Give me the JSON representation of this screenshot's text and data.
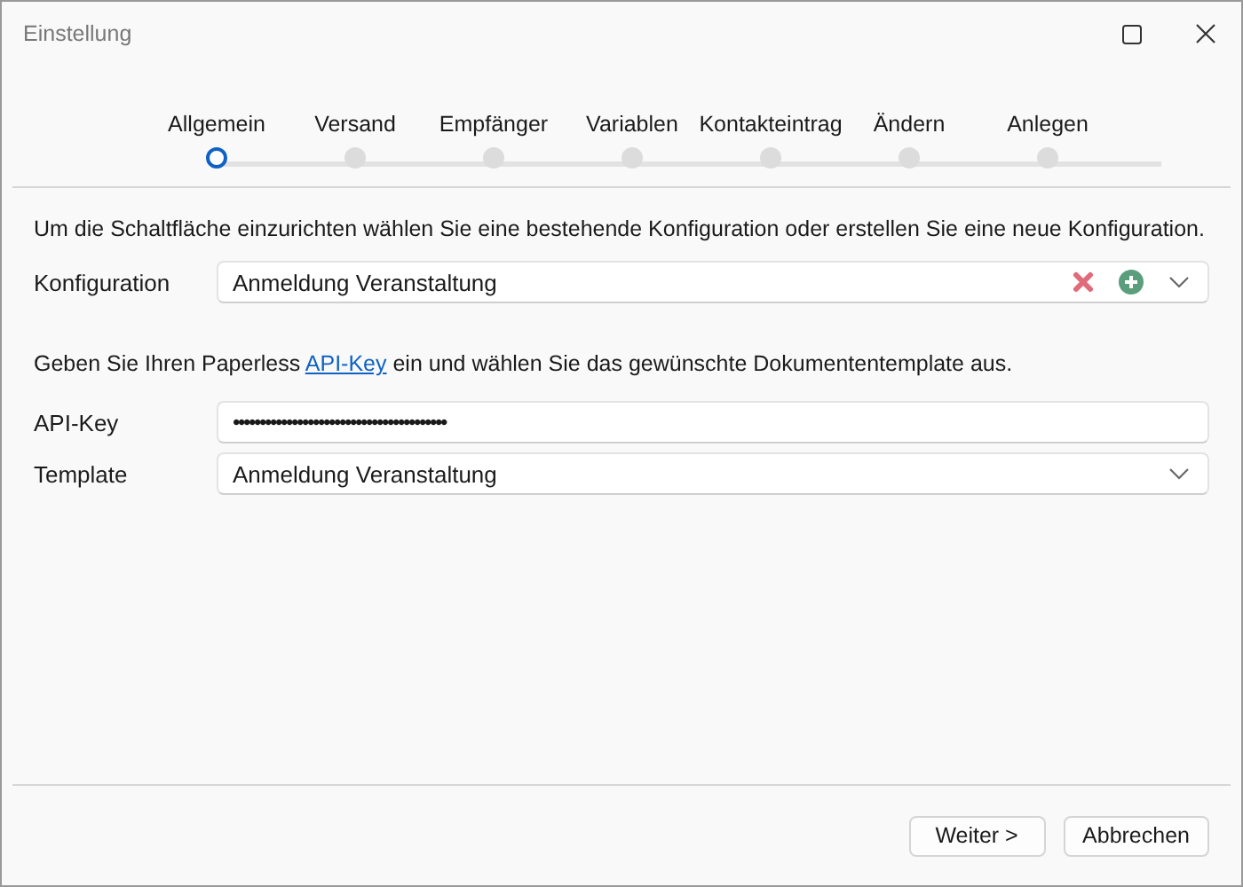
{
  "window": {
    "title": "Einstellung"
  },
  "steps": [
    {
      "label": "Allgemein",
      "selected": true
    },
    {
      "label": "Versand",
      "selected": false
    },
    {
      "label": "Empfänger",
      "selected": false
    },
    {
      "label": "Variablen",
      "selected": false
    },
    {
      "label": "Kontakteintrag",
      "selected": false
    },
    {
      "label": "Ändern",
      "selected": false
    },
    {
      "label": "Anlegen",
      "selected": false
    }
  ],
  "intro": "Um die Schaltfläche einzurichten wählen Sie eine bestehende Konfiguration oder erstellen Sie eine neue Konfiguration.",
  "konfiguration": {
    "label": "Konfiguration",
    "value": "Anmeldung Veranstaltung"
  },
  "hint": {
    "before": "Geben Sie Ihren Paperless",
    "link": "API-Key",
    "after": "ein und wählen Sie das gewünschte Dokumententemplate aus."
  },
  "api_key": {
    "label": "API-Key",
    "value": "••••••••••••••••••••••••••••••••••••••••"
  },
  "template": {
    "label": "Template",
    "value": "Anmeldung Veranstaltung"
  },
  "buttons": [
    "Weiter >",
    "Abbrechen"
  ]
}
